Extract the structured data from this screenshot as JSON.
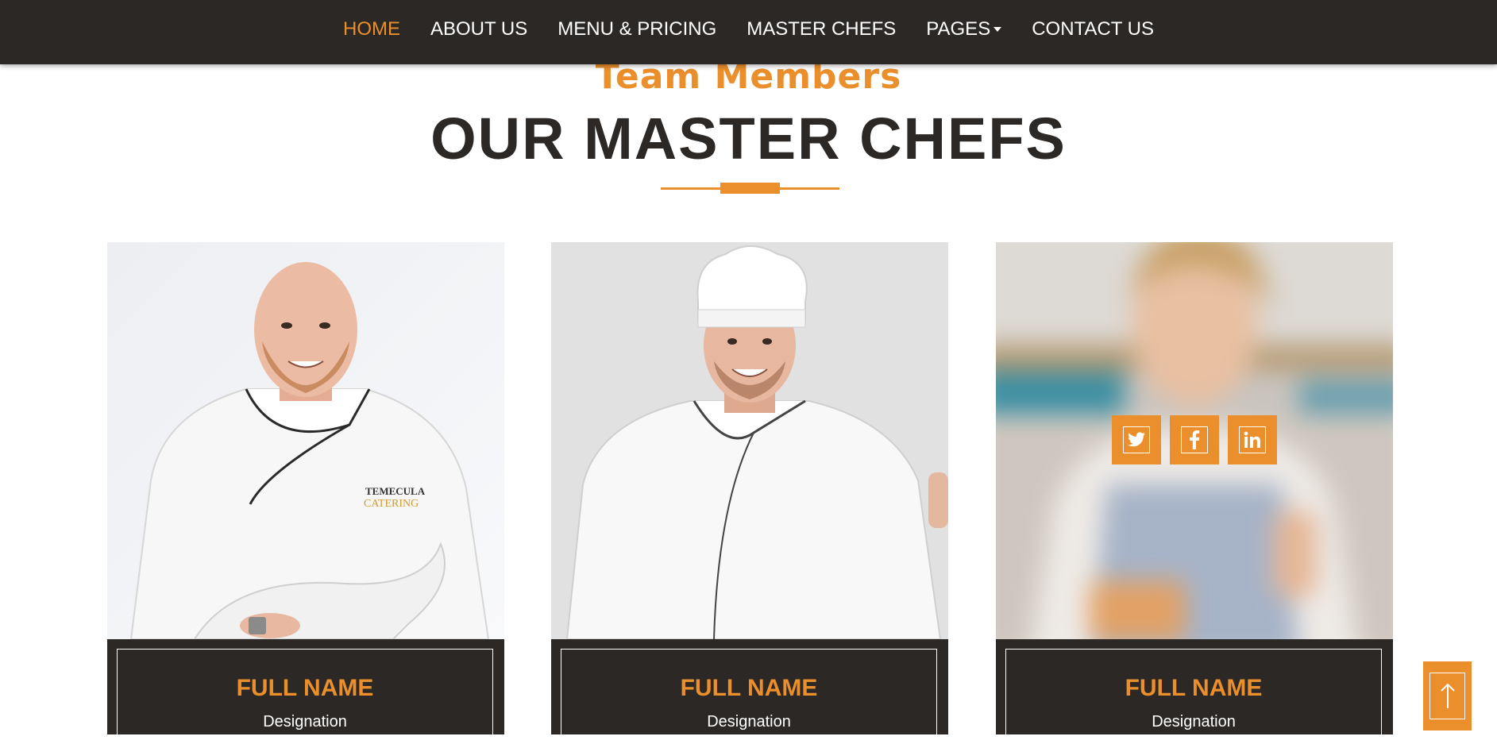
{
  "nav": {
    "items": [
      {
        "label": "HOME",
        "active": true
      },
      {
        "label": "ABOUT US",
        "active": false
      },
      {
        "label": "MENU & PRICING",
        "active": false
      },
      {
        "label": "MASTER CHEFS",
        "active": false
      },
      {
        "label": "PAGES",
        "active": false,
        "dropdown": true
      },
      {
        "label": "CONTACT US",
        "active": false
      }
    ]
  },
  "section": {
    "subtitle": "Team Members",
    "title": "OUR MASTER CHEFS"
  },
  "chefs": [
    {
      "name": "FULL NAME",
      "designation": "Designation",
      "photo": "chef-bald-arms-crossed"
    },
    {
      "name": "FULL NAME",
      "designation": "Designation",
      "photo": "chef-toque-smiling"
    },
    {
      "name": "FULL NAME",
      "designation": "Designation",
      "photo": "baker-woman-thumbs-up",
      "hover": true
    }
  ],
  "social_icons": [
    "twitter-icon",
    "facebook-icon",
    "linkedin-icon"
  ],
  "colors": {
    "accent": "#ea8f2b",
    "dark": "#2b2826",
    "white": "#ffffff"
  }
}
